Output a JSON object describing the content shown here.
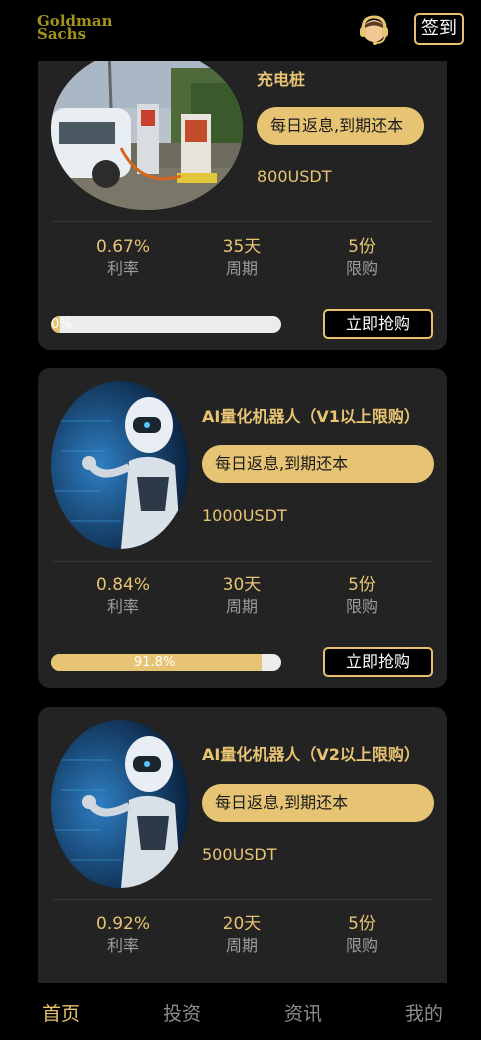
{
  "header": {
    "logo_line1": "Goldman",
    "logo_line2": "Sachs",
    "support_icon": "customer-service-headset-icon",
    "signin_label": "签到"
  },
  "products": [
    {
      "name": "充电桩",
      "tag": "每日返息,到期还本",
      "price": "800USDT",
      "rate": "0.67%",
      "rate_label": "利率",
      "cycle": "35天",
      "cycle_label": "周期",
      "limit": "5份",
      "limit_label": "限购",
      "progress_label": "0%",
      "progress": 0.04,
      "buy_label": "立即抢购",
      "image": "ev-charging-station-photo"
    },
    {
      "name": "AI量化机器人（V1以上限购）",
      "tag": "每日返息,到期还本",
      "price": "1000USDT",
      "rate": "0.84%",
      "rate_label": "利率",
      "cycle": "30天",
      "cycle_label": "周期",
      "limit": "5份",
      "limit_label": "限购",
      "progress_label": "91.8%",
      "progress": 0.918,
      "buy_label": "立即抢购",
      "image": "ai-robot-photo"
    },
    {
      "name": "AI量化机器人（V2以上限购）",
      "tag": "每日返息,到期还本",
      "price": "500USDT",
      "rate": "0.92%",
      "rate_label": "利率",
      "cycle": "20天",
      "cycle_label": "周期",
      "limit": "5份",
      "limit_label": "限购",
      "image": "ai-robot-photo"
    }
  ],
  "tabs": [
    {
      "label": "首页",
      "active": true
    },
    {
      "label": "投资",
      "active": false
    },
    {
      "label": "资讯",
      "active": false
    },
    {
      "label": "我的",
      "active": false
    }
  ],
  "colors": {
    "gold": "#e8c472",
    "pill": "#e6c474",
    "card": "#232323",
    "background": "#000000"
  }
}
